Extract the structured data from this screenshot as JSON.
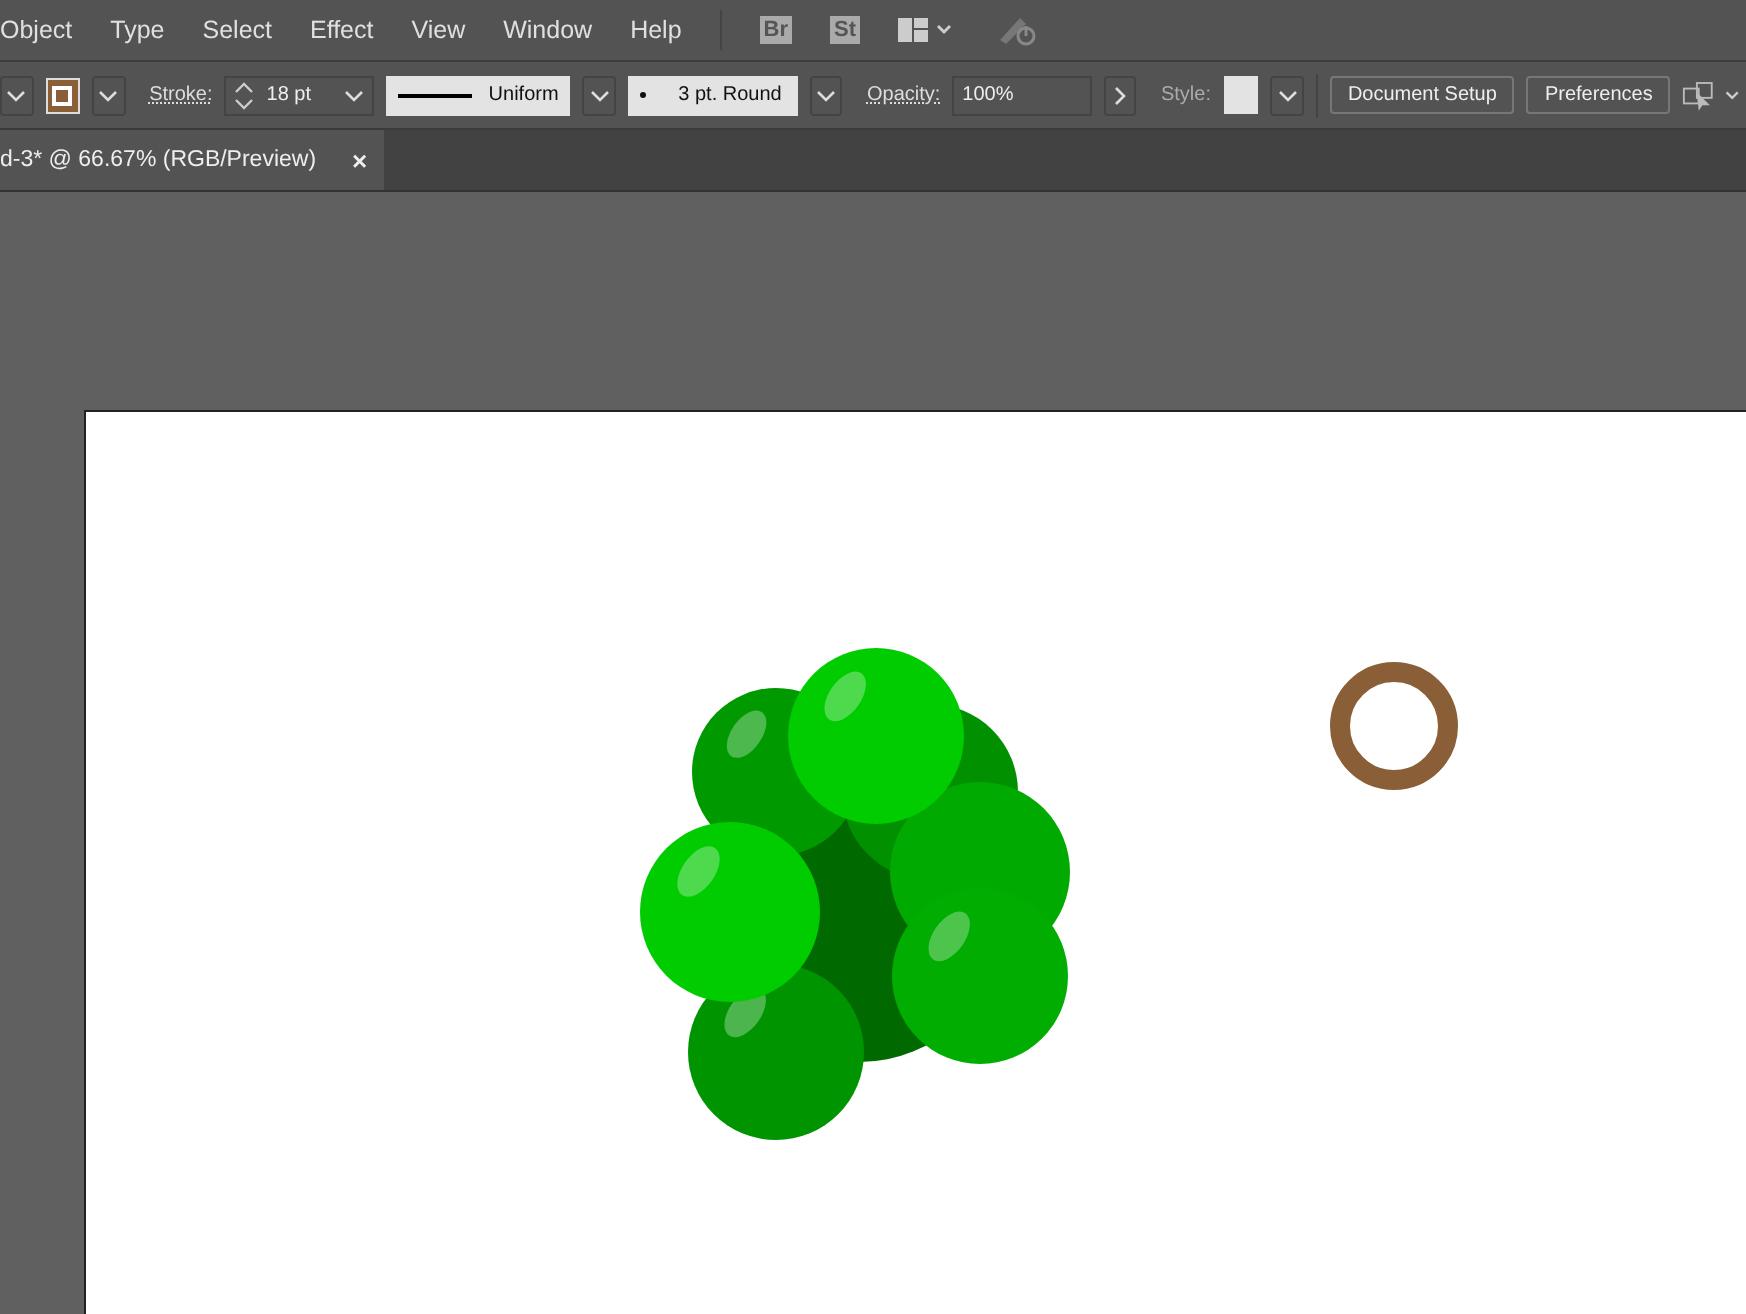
{
  "menu": [
    "Object",
    "Type",
    "Select",
    "Effect",
    "View",
    "Window",
    "Help"
  ],
  "app_buttons": [
    "Br",
    "St"
  ],
  "control_bar": {
    "stroke_label": "Stroke:",
    "stroke_value": "18 pt",
    "profile": "Uniform",
    "brush": "3 pt. Round",
    "opacity_label": "Opacity:",
    "opacity_value": "100%",
    "style_label": "Style:",
    "buttons": [
      "Document Setup",
      "Preferences"
    ]
  },
  "tabs": [
    {
      "label": "d-3* @ 66.67% (RGB/Preview)",
      "selected": true,
      "close": "×"
    }
  ]
}
